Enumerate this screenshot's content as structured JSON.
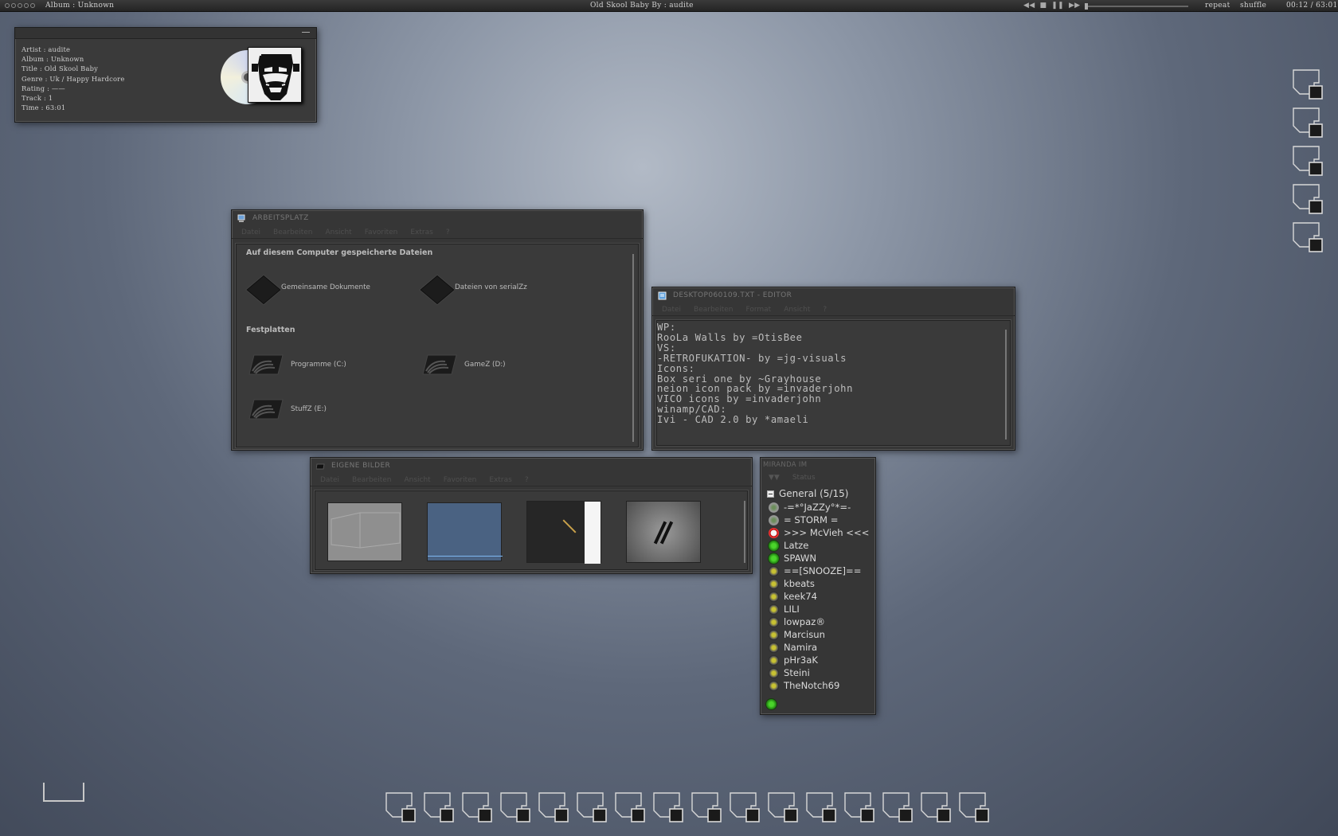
{
  "topbar": {
    "album": "Album : Unknown",
    "now_playing": "Old Skool Baby By : audite",
    "repeat": "repeat",
    "shuffle": "shuffle",
    "time": "00:12 / 63:01",
    "seek_fraction": 0.003
  },
  "info": {
    "artist": "Artist : audite",
    "album": "Album : Unknown",
    "title": "Title : Old Skool Baby",
    "genre": "Genre : Uk / Happy Hardcore",
    "rating": "Rating : ——",
    "track": "Track : 1",
    "time": "Time : 63:01"
  },
  "arbeitsplatz": {
    "title": "ARBEITSPLATZ",
    "menu": [
      "Datei",
      "Bearbeiten",
      "Ansicht",
      "Favoriten",
      "Extras",
      "?"
    ],
    "section1": "Auf diesem Computer gespeicherte Dateien",
    "shared_docs": "Gemeinsame Dokumente",
    "user_docs": "Dateien von serialZz",
    "section2": "Festplatten",
    "drive_c": "Programme (C:)",
    "drive_d": "GameZ (D:)",
    "drive_e": "StuffZ (E:)"
  },
  "editor": {
    "title": "DESKTOP060109.TXT - EDITOR",
    "menu": [
      "Datei",
      "Bearbeiten",
      "Format",
      "Ansicht",
      "?"
    ],
    "text": "WP:\nRooLa Walls by =OtisBee\nVS:\n-RETROFUKATION- by =jg-visuals\nIcons:\nBox seri one by ~Grayhouse\nneion icon pack by =invaderjohn\nVICO icons by =invaderjohn\nwinamp/CAD:\nIvi - CAD 2.0 by *amaeli"
  },
  "bilder": {
    "title": "EIGENE BILDER",
    "menu": [
      "Datei",
      "Bearbeiten",
      "Ansicht",
      "Favoriten",
      "Extras",
      "?"
    ]
  },
  "miranda": {
    "title": "MIRANDA IM",
    "status": "Status",
    "group": "General (5/15)",
    "contacts": [
      {
        "name": "-=*°JaZZy°*=-",
        "status": "away"
      },
      {
        "name": "= STORM =",
        "status": "away"
      },
      {
        "name": ">>> McVieh <<<",
        "status": "na"
      },
      {
        "name": "Latze",
        "status": "on"
      },
      {
        "name": "SPAWN",
        "status": "on"
      },
      {
        "name": "==[SNOOZE]==",
        "status": "off"
      },
      {
        "name": "kbeats",
        "status": "off"
      },
      {
        "name": "keek74",
        "status": "off"
      },
      {
        "name": "LILI",
        "status": "off"
      },
      {
        "name": "lowpaz®",
        "status": "off"
      },
      {
        "name": "Marcisun",
        "status": "off"
      },
      {
        "name": "Namira",
        "status": "off"
      },
      {
        "name": "pHr3aK",
        "status": "off"
      },
      {
        "name": "Steini",
        "status": "off"
      },
      {
        "name": "TheNotch69",
        "status": "off"
      }
    ]
  },
  "colors": {
    "accent_online": "#3cc01c",
    "bg_window": "#363636"
  }
}
